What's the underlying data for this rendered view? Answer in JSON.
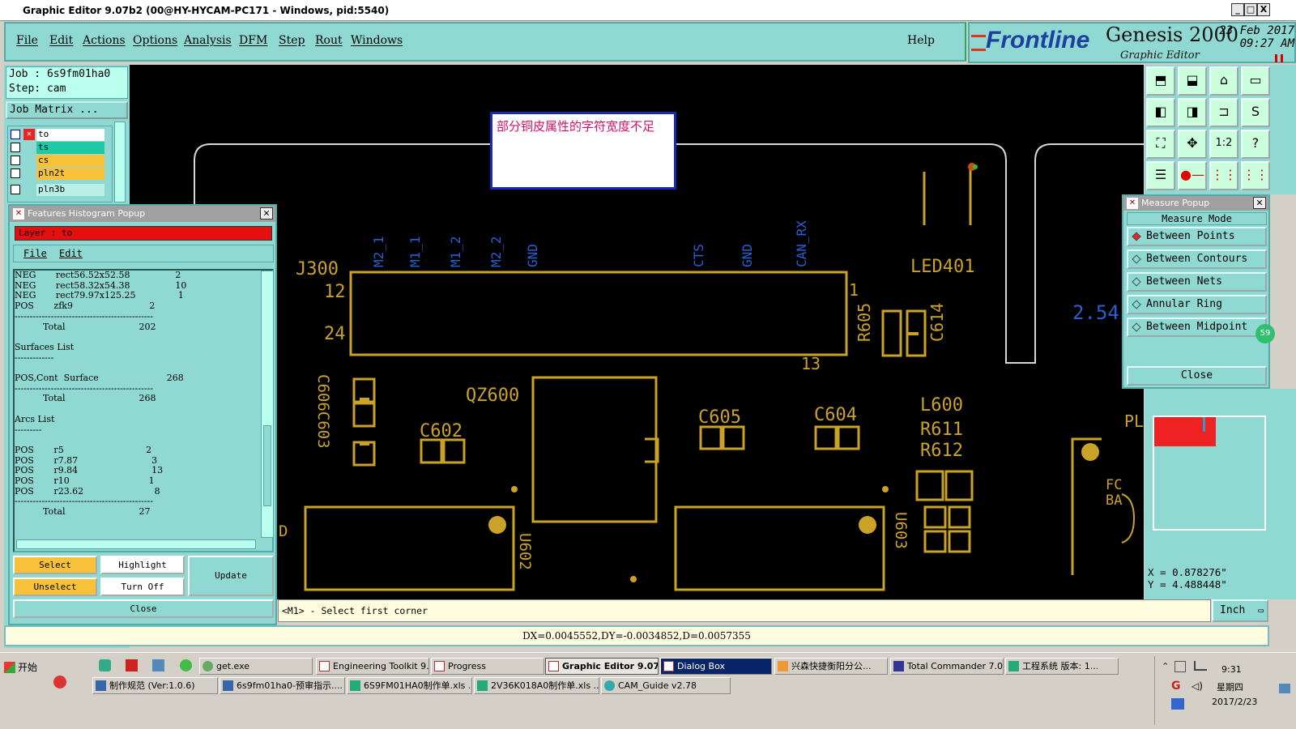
{
  "window": {
    "title": "Graphic Editor 9.07b2 (00@HY-HYCAM-PC171 - Windows, pid:5540)",
    "controls": [
      "_",
      "□",
      "X"
    ]
  },
  "menu": {
    "items": [
      "File",
      "Edit",
      "Actions",
      "Options",
      "Analysis",
      "DFM",
      "Step",
      "Rout",
      "Windows"
    ],
    "help": "Help"
  },
  "brand": {
    "frontline": "Frontline",
    "product": "Genesis 2000",
    "subtitle": "Graphic Editor",
    "date": "23 Feb 2017",
    "time": "09:27 AM"
  },
  "job": {
    "job_line": "Job : 6s9fm01ha0",
    "step_line": "Step: cam",
    "matrix_button": "Job Matrix ..."
  },
  "layers": [
    {
      "name": "to",
      "color": "#ffffff"
    },
    {
      "name": "ts",
      "color": "#1fc9a6"
    },
    {
      "name": "cs",
      "color": "#f7c23a"
    },
    {
      "name": "pln2t",
      "color": "#f7c23a"
    },
    {
      "name": "pln3b",
      "color": "#b8f0e8"
    }
  ],
  "annotation": {
    "text": "部分铜皮属性的字符宽度不足"
  },
  "pcb_labels": {
    "j300": "J300",
    "pin12": "12",
    "pin24": "24",
    "pin1": "1",
    "pin13": "13",
    "led": "LED401",
    "r605": "R605",
    "c614": "C614",
    "qz600": "QZ600",
    "c602": "C602",
    "c605": "C605",
    "c604": "C604",
    "l600": "L600",
    "r611": "R611",
    "r612": "R612",
    "c606": "C606C603",
    "u602": "U602",
    "u603": "U603",
    "dim": "2.54",
    "pl": "PL",
    "d": "D",
    "fcba": "FCBA",
    "net_labels": [
      "M2_1",
      "M1_1",
      "M1_2",
      "M2_2",
      "GND",
      "CTS",
      "GND",
      "CAN_RX"
    ]
  },
  "features_popup": {
    "title": "Features Histogram Popup",
    "layer_label": "Layer :   to",
    "menu": [
      "File",
      "Edit"
    ],
    "list_lines": [
      "NEG       rect56.52x52.58                2",
      "NEG       rect58.32x54.38                10",
      "NEG       rect79.97x125.25               1",
      "POS       zfk9                           2",
      "----------------------------------------------",
      "          Total                          202",
      "",
      "Surfaces List",
      "-------------",
      "",
      "POS,Cont  Surface                        268",
      "----------------------------------------------",
      "          Total                          268",
      "",
      "Arcs List",
      "---------",
      "",
      "POS       r5                             2",
      "POS       r7.87                          3",
      "POS       r9.84                          13",
      "POS       r10                            1",
      "POS       r23.62                         8",
      "----------------------------------------------",
      "          Total                          27"
    ],
    "buttons": {
      "select": "Select",
      "highlight": "Highlight",
      "update": "Update",
      "unselect": "Unselect",
      "turn_off": "Turn Off",
      "close": "Close"
    }
  },
  "measure_popup": {
    "title": "Measure Popup",
    "mode_label": "Measure Mode",
    "options": [
      "Between Points",
      "Between Contours",
      "Between Nets",
      "Annular Ring",
      "Between Midpoint"
    ],
    "selected_index": 0,
    "close": "Close",
    "badge": "59"
  },
  "coords": {
    "x": "X = 0.878276\"",
    "y": "Y = 4.488448\""
  },
  "status_text": "<M1> - Select first corner",
  "units": "Inch",
  "delta_text": "DX=0.0045552,DY=-0.0034852,D=0.0057355",
  "taskbar": {
    "start": "开始",
    "row1": [
      "get.exe",
      "Engineering Toolkit 9....",
      "Progress",
      "Graphic Editor 9.07...",
      "Dialog Box",
      "兴森快捷衡阳分公...",
      "Total Commander 7.0...",
      "工程系统  版本: 1..."
    ],
    "row2": [
      "制作规范 (Ver:1.0.6)",
      "6s9fm01ha0-预审指示....",
      "6S9FM01HA0制作单.xls ...",
      "2V36K018A0制作单.xls ...",
      "CAM_Guide v2.78"
    ],
    "active": "Graphic Editor 9.07...",
    "clock_time": "9:31",
    "clock_day": "星期四",
    "clock_date": "2017/2/23"
  },
  "colors": {
    "panel": "#8fd9d2",
    "pcb_trace": "#c9a227",
    "net_label": "#2a5fd1",
    "canvas": "#000000",
    "annotation_text": "#d0106a"
  }
}
